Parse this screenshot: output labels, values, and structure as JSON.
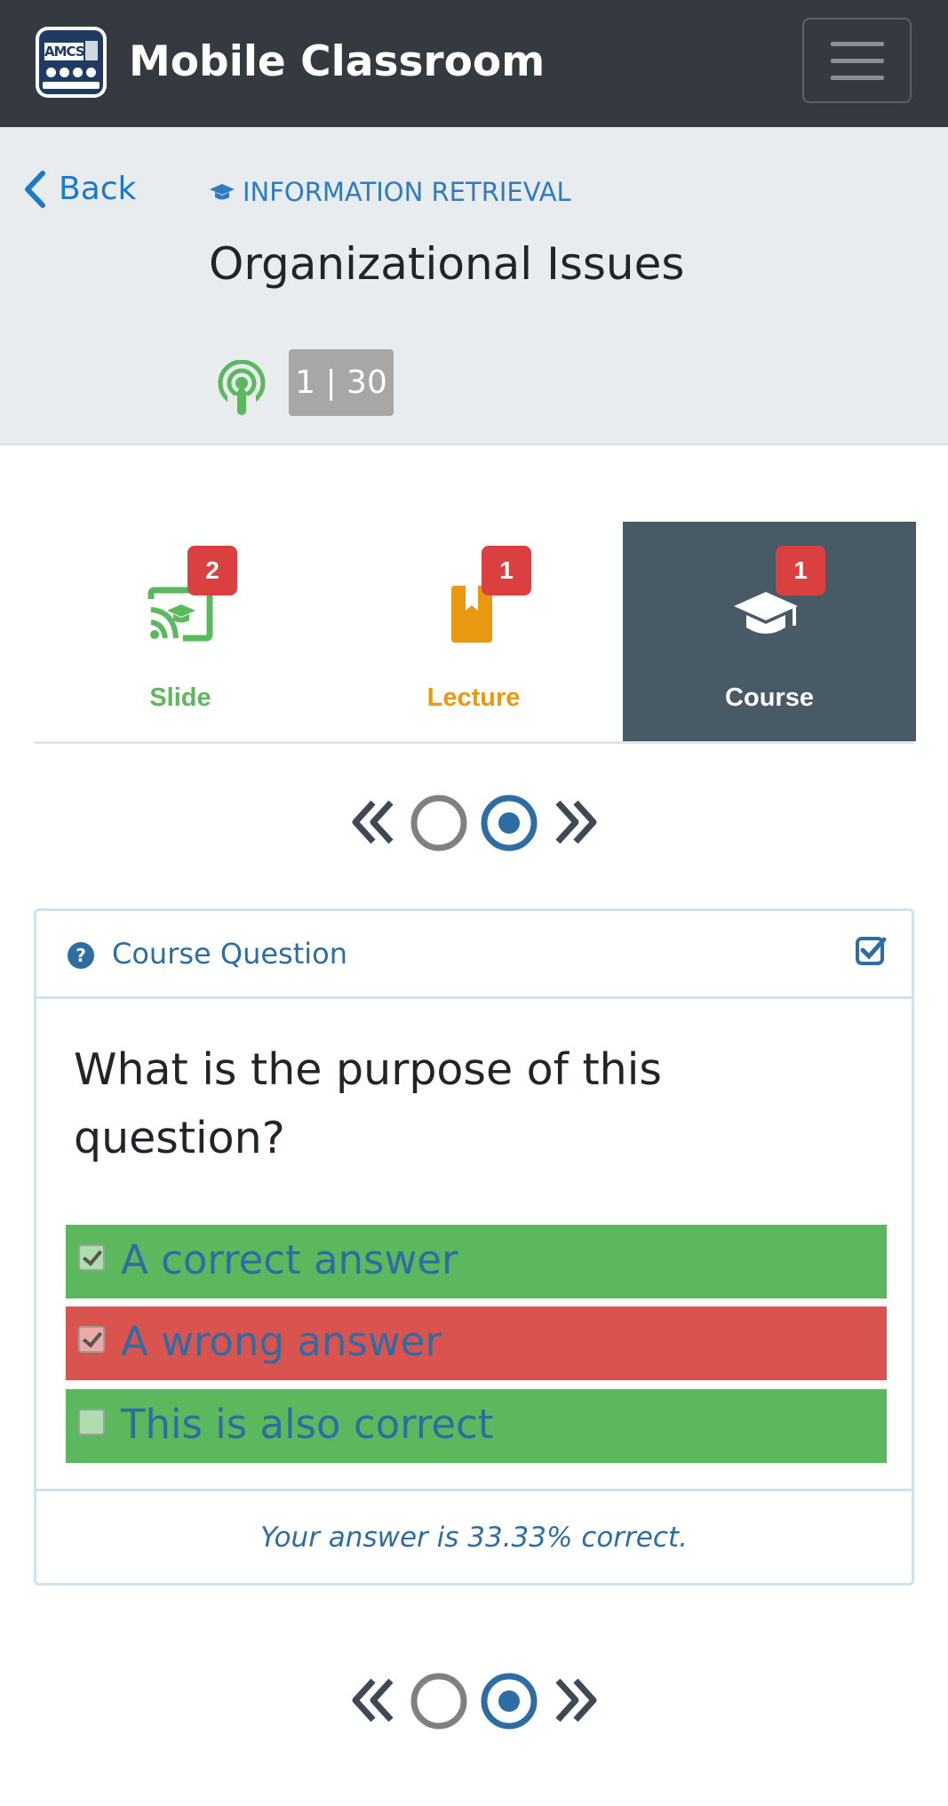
{
  "navbar": {
    "logo_text": "AMCS",
    "brand": "Mobile Classroom",
    "menu_icon": "hamburger-icon"
  },
  "header": {
    "back_label": "Back",
    "category": "INFORMATION RETRIEVAL",
    "title": "Organizational Issues",
    "counter": "1 | 30"
  },
  "tabs": [
    {
      "label": "Slide",
      "badge": "2",
      "icon": "cast-icon",
      "color": "#5cb85c",
      "active": false
    },
    {
      "label": "Lecture",
      "badge": "1",
      "icon": "bookmark-icon",
      "color": "#e8990f",
      "active": false
    },
    {
      "label": "Course",
      "badge": "1",
      "icon": "graduation-cap-icon",
      "color": "#ffffff",
      "active": true
    }
  ],
  "card": {
    "title": "Course Question",
    "question": "What is the purpose of this question?",
    "answers": [
      {
        "text": "A correct answer",
        "checked": true,
        "status": "correct"
      },
      {
        "text": "A wrong answer",
        "checked": true,
        "status": "wrong"
      },
      {
        "text": "This is also correct",
        "checked": false,
        "status": "correct"
      }
    ],
    "result": "Your answer is 33.33% correct."
  },
  "colors": {
    "navbar": "#343a40",
    "accent": "#2e6da4",
    "correct": "#5cb85c",
    "wrong": "#d9534f",
    "badge": "#d9403f",
    "active_tab": "#485a66"
  }
}
